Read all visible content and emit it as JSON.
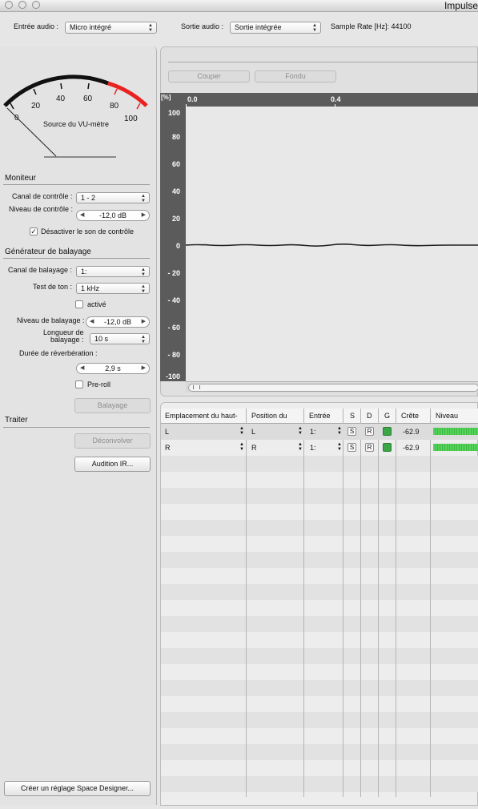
{
  "window": {
    "title": "Impulse"
  },
  "toolbar": {
    "audio_in_label": "Entrée audio :",
    "audio_in_value": "Micro intégré",
    "audio_out_label": "Sortie audio :",
    "audio_out_value": "Sortie intégrée",
    "sample_rate": "Sample Rate [Hz]: 44100"
  },
  "vu": {
    "scale": [
      "0",
      "20",
      "40",
      "60",
      "80",
      "100"
    ],
    "caption": "Source du VU-mètre",
    "red_zone_color": "#e8231f"
  },
  "monitor": {
    "title": "Moniteur",
    "channel_label": "Canal de contrôle :",
    "channel_value": "1 - 2",
    "level_label": "Niveau de contrôle :",
    "level_value": "-12,0 dB",
    "mute_label": "Désactiver le son de contrôle",
    "mute_checked": true
  },
  "sweep": {
    "title": "Générateur de balayage",
    "channel_label": "Canal de balayage :",
    "channel_value": "1:",
    "tone_label": "Test de ton :",
    "tone_value": "1 kHz",
    "active_label": "activé",
    "level_label": "Niveau de balayage :",
    "level_value": "-12,0 dB",
    "length_label_1": "Longueur de",
    "length_label_2": "balayage :",
    "length_value": "10 s",
    "reverb_label": "Durée de réverbération :",
    "reverb_value": "2,9 s",
    "preroll_label": "Pre-roll",
    "sweep_button": "Balayage"
  },
  "process": {
    "title": "Traiter",
    "deconvolve_button": "Déconvolver",
    "audition_button": "Audition IR..."
  },
  "create_button": "Créer un réglage Space Designer...",
  "edit": {
    "cut_button": "Couper",
    "fade_button": "Fondu"
  },
  "graph": {
    "unit": "[%]",
    "x_ticks": [
      "0.0",
      "0.4"
    ],
    "y_ticks": [
      "100",
      "80",
      "60",
      "40",
      "20",
      "0",
      "- 20",
      "- 40",
      "- 60",
      "- 80",
      "-100"
    ]
  },
  "table": {
    "headers": [
      "Emplacement du haut-",
      "Position du",
      "Entrée",
      "S",
      "D",
      "G",
      "Crête",
      "Niveau"
    ],
    "rows": [
      {
        "speaker": "L",
        "position": "L",
        "input": "1:",
        "s": "S",
        "d": "R",
        "peak": "-62.9"
      },
      {
        "speaker": "R",
        "position": "R",
        "input": "1:",
        "s": "S",
        "d": "R",
        "peak": "-62.9"
      }
    ]
  }
}
